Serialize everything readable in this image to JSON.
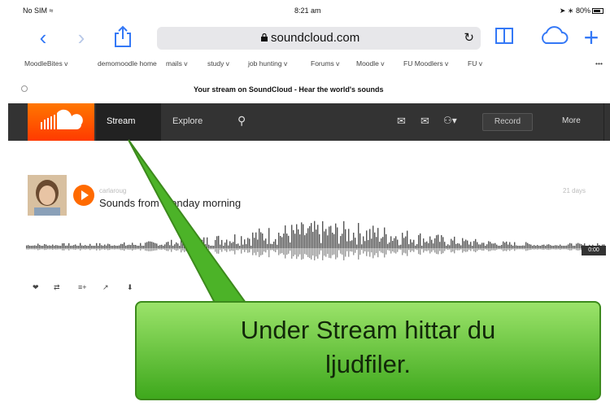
{
  "status_bar": {
    "carrier": "No SIM",
    "time": "8:21 am",
    "battery": "80%"
  },
  "browser": {
    "url": "soundcloud.com",
    "page_title": "Your stream on SoundCloud - Hear the world's sounds",
    "bookmarks": [
      "MoodleBites v",
      "demomoodle home",
      "mails v",
      "study v",
      "job hunting v",
      "Forums v",
      "Moodle v",
      "FU Moodlers v",
      "FU v",
      "•••"
    ]
  },
  "soundcloud": {
    "nav": {
      "stream": "Stream",
      "explore": "Explore",
      "record": "Record",
      "more": "More"
    },
    "track": {
      "uploader": "carlaroug",
      "title": "Sounds from Monday morning",
      "time_ago": "21 days",
      "duration": "0:00"
    }
  },
  "callout": {
    "line1": "Under Stream hittar du",
    "line2": "ljudfiler."
  },
  "colors": {
    "sc_orange": "#ff5500",
    "header_bg": "#333333",
    "callout_green": "#5cc22e",
    "ios_blue": "#3478f6"
  }
}
